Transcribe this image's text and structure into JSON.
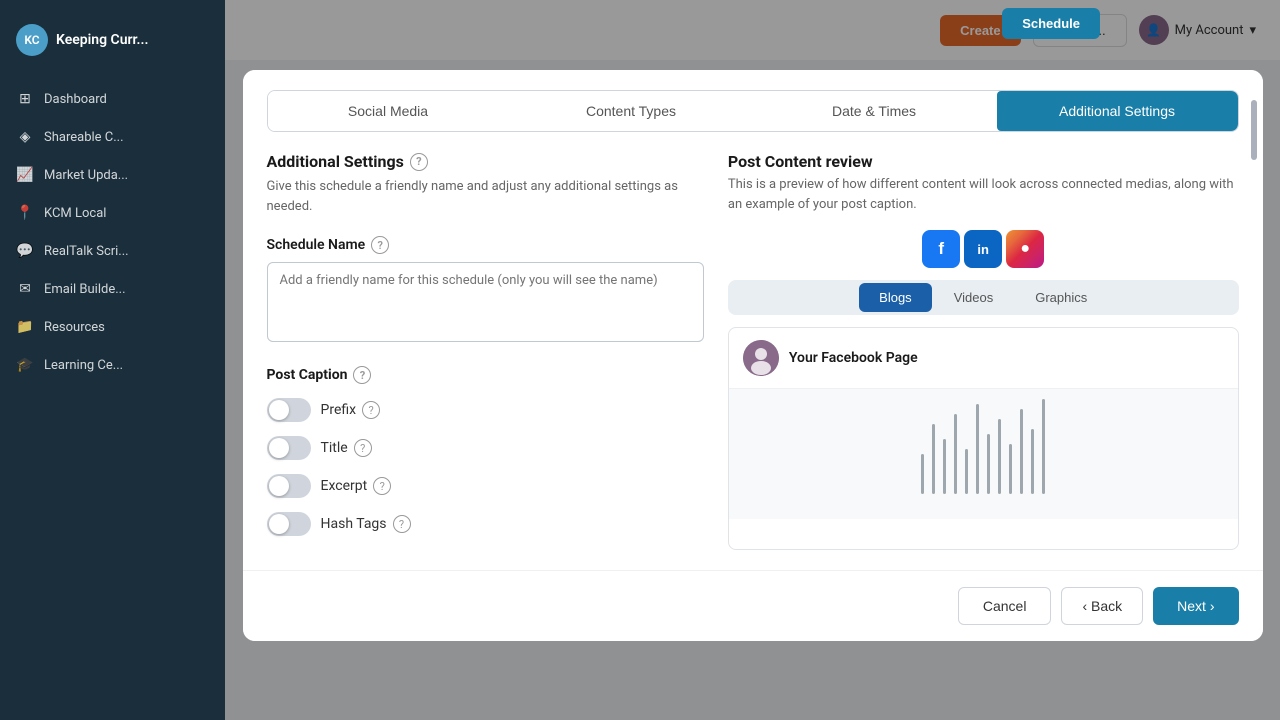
{
  "sidebar": {
    "logo_text": "Keeping Curr...",
    "items": [
      {
        "id": "dashboard",
        "label": "Dashboard",
        "icon": "⊞"
      },
      {
        "id": "shareable",
        "label": "Shareable C...",
        "icon": "◈"
      },
      {
        "id": "market",
        "label": "Market Upda...",
        "icon": "📈"
      },
      {
        "id": "kcm-local",
        "label": "KCM Local",
        "icon": "📍"
      },
      {
        "id": "realtalk",
        "label": "RealTalk Scri...",
        "icon": "💬"
      },
      {
        "id": "email-builder",
        "label": "Email Builde...",
        "icon": "✉"
      },
      {
        "id": "resources",
        "label": "Resources",
        "icon": "📁"
      },
      {
        "id": "learning",
        "label": "Learning Ce...",
        "icon": "🎓"
      }
    ]
  },
  "topbar": {
    "account_label": "My Account",
    "schedule_btn": "Schedule"
  },
  "modal": {
    "tabs": [
      {
        "id": "social-media",
        "label": "Social Media",
        "active": false
      },
      {
        "id": "content-types",
        "label": "Content Types",
        "active": false
      },
      {
        "id": "date-times",
        "label": "Date & Times",
        "active": false
      },
      {
        "id": "additional-settings",
        "label": "Additional Settings",
        "active": true
      }
    ],
    "left": {
      "title": "Additional Settings",
      "description": "Give this schedule a friendly name and adjust any additional settings as needed.",
      "schedule_name_label": "Schedule Name",
      "schedule_name_placeholder": "Add a friendly name for this schedule (only you will see the name)",
      "post_caption_label": "Post Caption",
      "toggles": [
        {
          "id": "prefix",
          "label": "Prefix",
          "on": false
        },
        {
          "id": "title",
          "label": "Title",
          "on": false
        },
        {
          "id": "excerpt",
          "label": "Excerpt",
          "on": false
        },
        {
          "id": "hash-tags",
          "label": "Hash Tags",
          "on": false
        }
      ]
    },
    "right": {
      "title": "Post Content review",
      "description": "This is a preview of how different content will look across connected medias, along with an example of your post caption.",
      "social_buttons": [
        {
          "id": "facebook",
          "icon": "f",
          "label": "Facebook"
        },
        {
          "id": "linkedin",
          "icon": "in",
          "label": "LinkedIn"
        },
        {
          "id": "instagram",
          "icon": "📷",
          "label": "Instagram"
        }
      ],
      "content_tabs": [
        {
          "id": "blogs",
          "label": "Blogs",
          "active": true
        },
        {
          "id": "videos",
          "label": "Videos",
          "active": false
        },
        {
          "id": "graphics",
          "label": "Graphics",
          "active": false
        }
      ],
      "preview": {
        "page_name": "Your Facebook Page",
        "avatar_text": "👤"
      }
    },
    "footer": {
      "cancel_label": "Cancel",
      "back_label": "‹ Back",
      "next_label": "Next ›"
    }
  }
}
